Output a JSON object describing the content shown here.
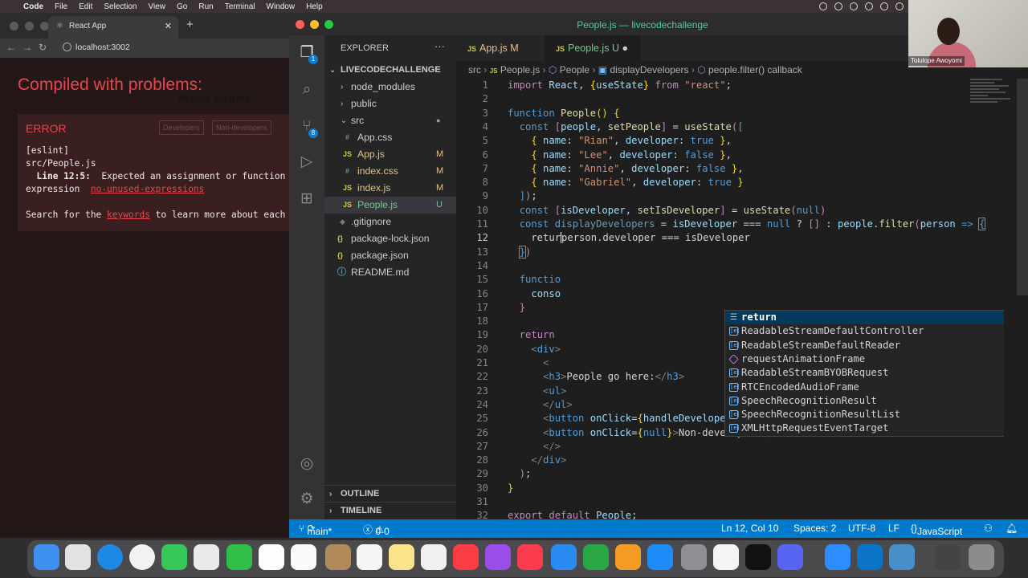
{
  "menubar": {
    "app": "Code",
    "items": [
      "File",
      "Edit",
      "Selection",
      "View",
      "Go",
      "Run",
      "Terminal",
      "Window",
      "Help"
    ]
  },
  "browser": {
    "tab_title": "React App",
    "url": "localhost:3002",
    "overlay_title": "Compiled with problems:",
    "bg_heading": "People go here:",
    "bg_buttons": [
      "Developers",
      "Non-developers"
    ],
    "error_label": "ERROR",
    "error_line1": "[eslint]",
    "error_line2": "src/People.js",
    "error_line3_bold": "Line 12:5:",
    "error_line3_rest": "  Expected an assignment or function ca",
    "error_line4": "expression  ",
    "error_rule": "no-unused-expressions",
    "error_line5_a": "Search for the ",
    "error_keywords": "keywords",
    "error_line5_b": " to learn more about each er"
  },
  "vscode": {
    "title": "People.js — livecodechallenge",
    "explorer_title": "EXPLORER",
    "project": "LIVECODECHALLENGE",
    "tree": [
      {
        "name": "node_modules",
        "twisty": "›",
        "status": ""
      },
      {
        "name": "public",
        "twisty": "›",
        "status": ""
      },
      {
        "name": "src",
        "twisty": "⌄",
        "status": "●"
      },
      {
        "name": "App.css",
        "icon": "#",
        "status": ""
      },
      {
        "name": "App.js",
        "icon": "JS",
        "status": "M"
      },
      {
        "name": "index.css",
        "icon": "#",
        "status": "M"
      },
      {
        "name": "index.js",
        "icon": "JS",
        "status": "M"
      },
      {
        "name": "People.js",
        "icon": "JS",
        "status": "U"
      },
      {
        "name": ".gitignore",
        "icon": "◆",
        "status": ""
      },
      {
        "name": "package-lock.json",
        "icon": "{}",
        "status": ""
      },
      {
        "name": "package.json",
        "icon": "{}",
        "status": ""
      },
      {
        "name": "README.md",
        "icon": "ⓘ",
        "status": ""
      }
    ],
    "outline": "OUTLINE",
    "timeline": "TIMELINE",
    "tabs": [
      {
        "label": "App.js",
        "status": "M"
      },
      {
        "label": "People.js",
        "status": "U"
      }
    ],
    "breadcrumb": [
      "src",
      "People.js",
      "People",
      "displayDevelopers",
      "people.filter() callback"
    ],
    "line_numbers": [
      1,
      2,
      3,
      4,
      5,
      6,
      7,
      8,
      9,
      10,
      11,
      12,
      13,
      14,
      15,
      16,
      17,
      18,
      19,
      20,
      21,
      22,
      23,
      24,
      25,
      26,
      27,
      28,
      29,
      30,
      31,
      32
    ],
    "suggestions": [
      {
        "label": "return",
        "detail": "return",
        "kind": "keyword"
      },
      {
        "label": "ReadableStreamDefaultController",
        "detail": "",
        "kind": "class"
      },
      {
        "label": "ReadableStreamDefaultReader",
        "detail": "",
        "kind": "class"
      },
      {
        "label": "requestAnimationFrame",
        "detail": "",
        "kind": "method"
      },
      {
        "label": "ReadableStreamBYOBRequest",
        "detail": "",
        "kind": "class"
      },
      {
        "label": "RTCEncodedAudioFrame",
        "detail": "",
        "kind": "class"
      },
      {
        "label": "SpeechRecognitionResult",
        "detail": "",
        "kind": "class"
      },
      {
        "label": "SpeechRecognitionResultList",
        "detail": "",
        "kind": "class"
      },
      {
        "label": "XMLHttpRequestEventTarget",
        "detail": "",
        "kind": "class"
      }
    ],
    "status": {
      "branch": "main*",
      "errors": "0",
      "warnings": "0",
      "position": "Ln 12, Col 10",
      "spaces": "Spaces: 2",
      "encoding": "UTF-8",
      "eol": "LF",
      "language": "JavaScript"
    }
  },
  "webcam": {
    "name": "Tolulope Awoyomi"
  },
  "colors": {
    "accent": "#007acc",
    "error": "#e8454d",
    "modified": "#e2c08d",
    "untracked": "#73c991"
  }
}
